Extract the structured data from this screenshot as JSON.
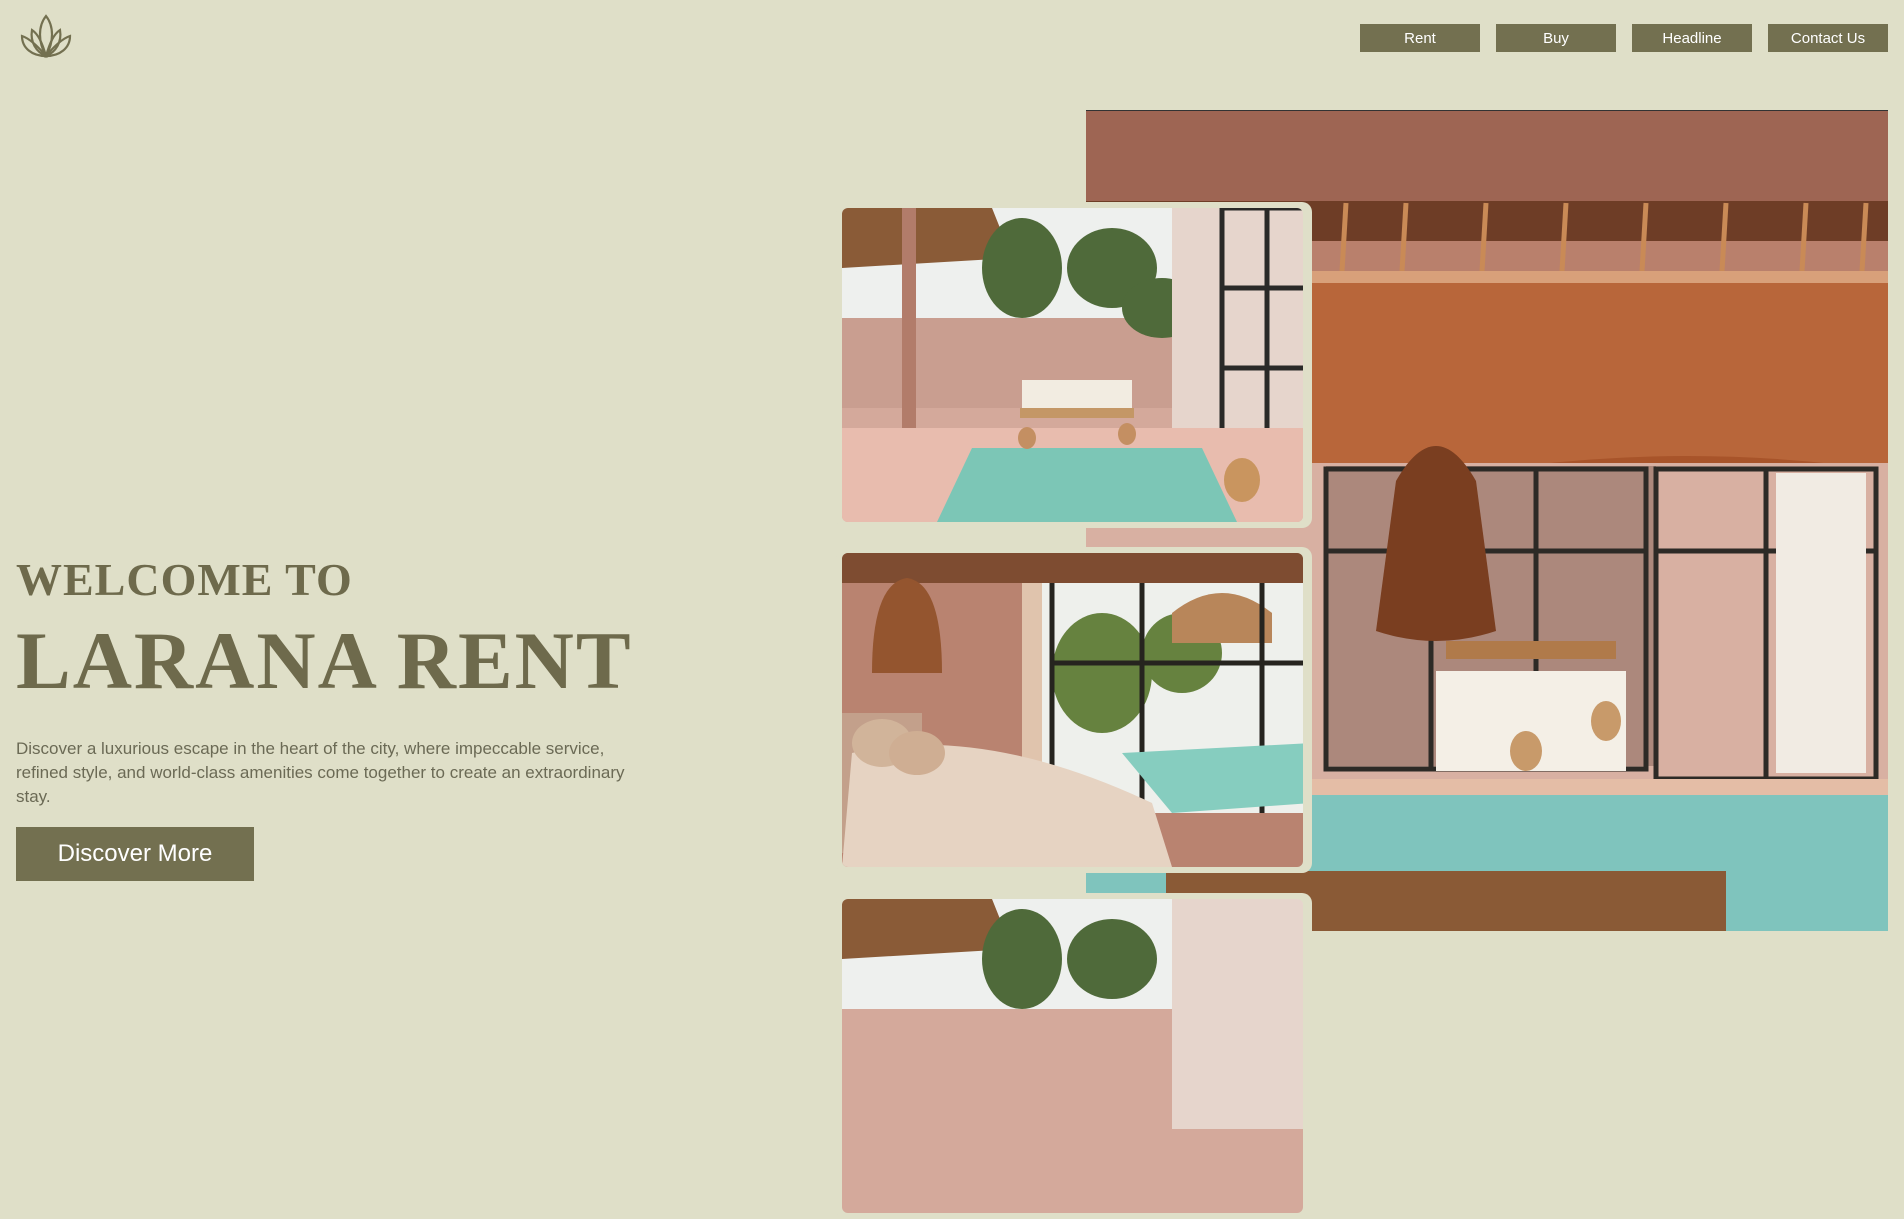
{
  "logo": {
    "icon": "lotus-icon"
  },
  "nav": {
    "items": [
      {
        "label": "Rent"
      },
      {
        "label": "Buy"
      },
      {
        "label": "Headline"
      },
      {
        "label": "Contact Us"
      }
    ]
  },
  "hero": {
    "welcome": "WELCOME TO",
    "brand": "LARANA RENT",
    "description": "Discover a luxurious escape in the heart of the city, where impeccable service, refined style, and world-class amenities come together to create an extraordinary stay.",
    "cta_label": "Discover More"
  },
  "colors": {
    "background": "#dfdfc8",
    "accent": "#737050",
    "heading": "#6e6a4c",
    "body_text": "#6b6a55"
  }
}
